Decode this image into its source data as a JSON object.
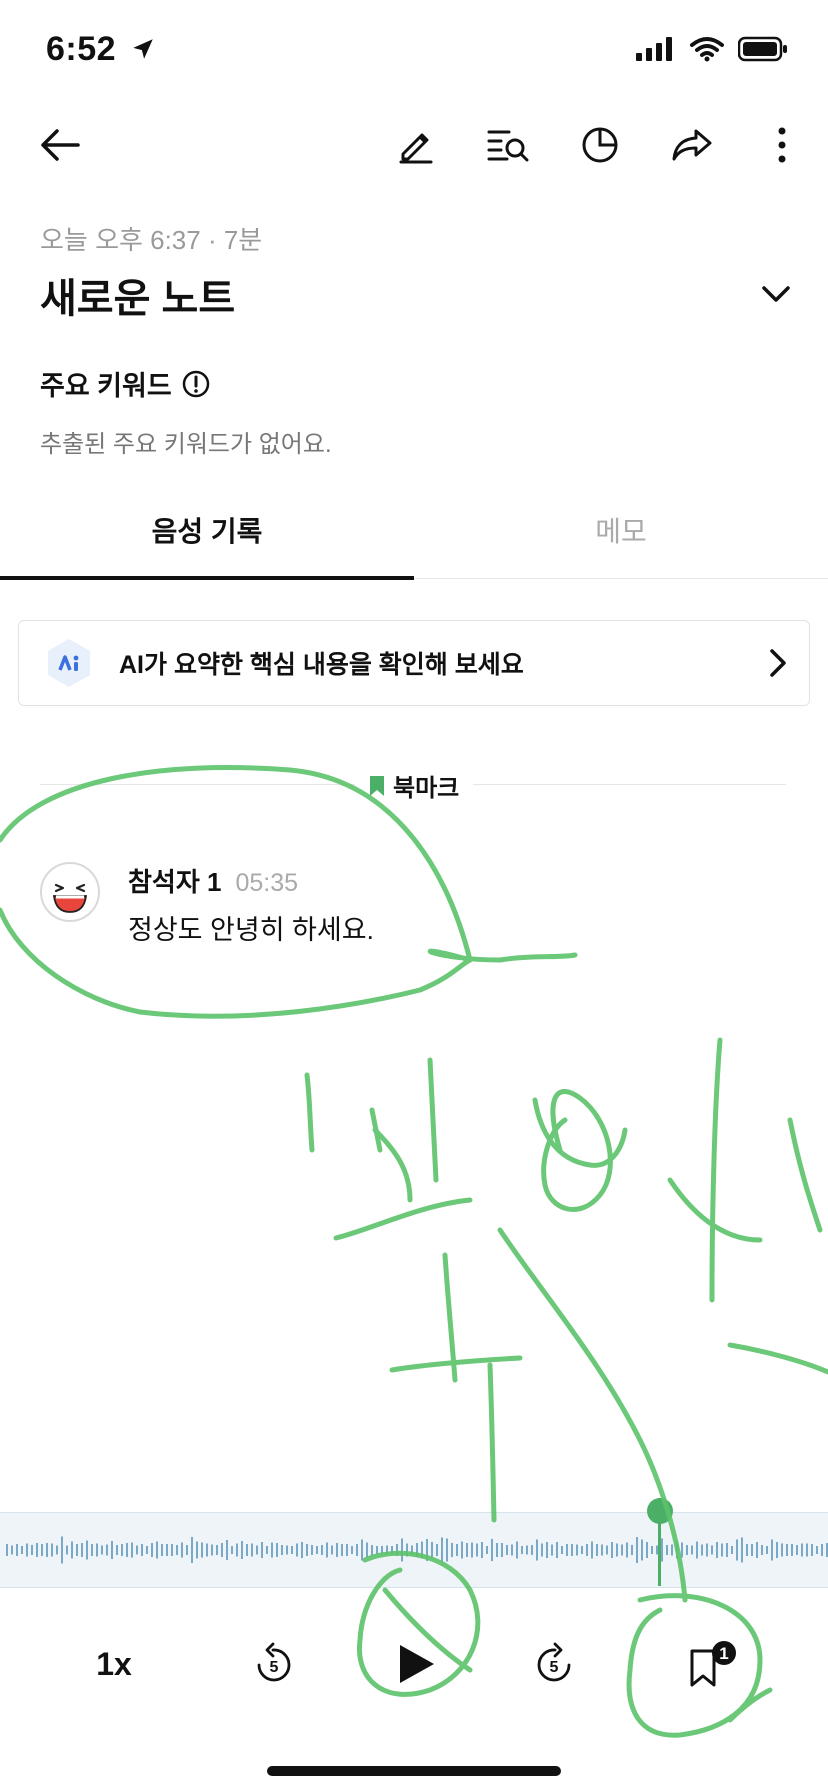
{
  "status_bar": {
    "time": "6:52"
  },
  "note": {
    "meta": "오늘 오후 6:37 · 7분",
    "title": "새로운 노트"
  },
  "keywords": {
    "title": "주요 키워드",
    "empty_message": "추출된 주요 키워드가 없어요."
  },
  "tabs": [
    {
      "label": "음성 기록",
      "active": true
    },
    {
      "label": "메모",
      "active": false
    }
  ],
  "ai_banner": {
    "text": "AI가 요약한 핵심 내용을 확인해 보세요"
  },
  "bookmark_divider": {
    "label": "북마크"
  },
  "transcript": [
    {
      "speaker": "참석자 1",
      "time": "05:35",
      "text": "정상도 안녕히 하세요."
    }
  ],
  "player": {
    "speed": "1x",
    "rewind_seconds": "5",
    "forward_seconds": "5",
    "bookmark_count": "1",
    "progress": 0.8
  },
  "colors": {
    "accent_green": "#4caf68",
    "ai_blue": "#3b6fe0",
    "waveform": "#7aa8c7",
    "scribble": "#5cc36a"
  },
  "icons": [
    "back-arrow-icon",
    "pencil-icon",
    "search-list-icon",
    "pie-chart-icon",
    "share-icon",
    "more-vertical-icon",
    "chevron-down-icon",
    "info-icon",
    "ai-icon",
    "chevron-right-icon",
    "bookmark-icon",
    "avatar-laughing-icon",
    "rewind-5-icon",
    "play-icon",
    "forward-5-icon",
    "bookmark-add-icon"
  ]
}
